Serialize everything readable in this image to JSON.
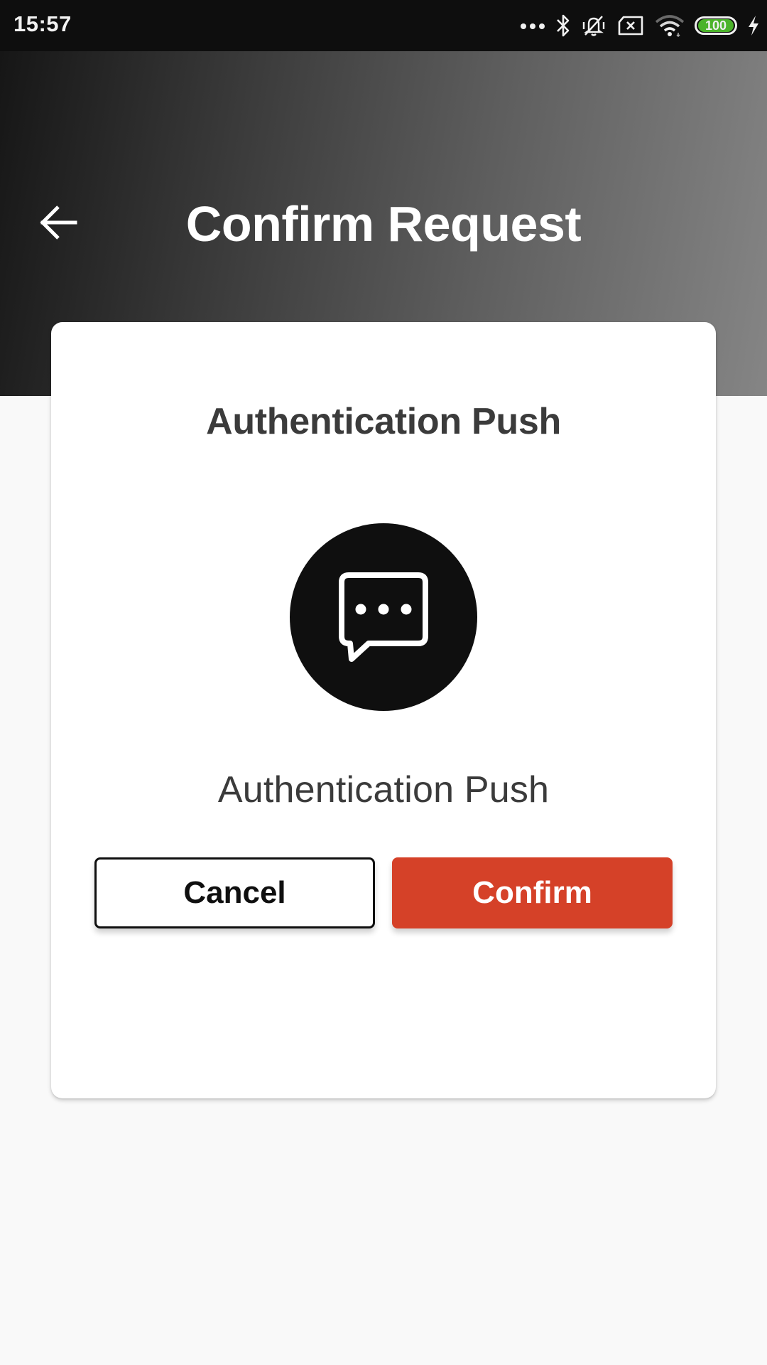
{
  "status_bar": {
    "time": "15:57",
    "battery_level": "100",
    "battery_percent": 100,
    "icons": [
      "more-notifications-icon",
      "bluetooth-icon",
      "vibrate-silent-icon",
      "no-sim-icon",
      "wifi-icon",
      "battery-icon",
      "charging-icon"
    ]
  },
  "header": {
    "title": "Confirm Request",
    "back_icon": "arrow-left-icon"
  },
  "card": {
    "title": "Authentication Push",
    "icon": "chat-bubble-dots-icon",
    "subtitle": "Authentication Push",
    "cancel_label": "Cancel",
    "confirm_label": "Confirm"
  },
  "colors": {
    "accent": "#d54128",
    "status_bar_bg": "#0e0e0e",
    "header_gradient_start": "#161616",
    "header_gradient_end": "#858585",
    "page_bg": "#f9f9f9",
    "card_bg": "#ffffff",
    "text_dark": "#3b3b3b",
    "battery_green": "#4bb32a"
  }
}
